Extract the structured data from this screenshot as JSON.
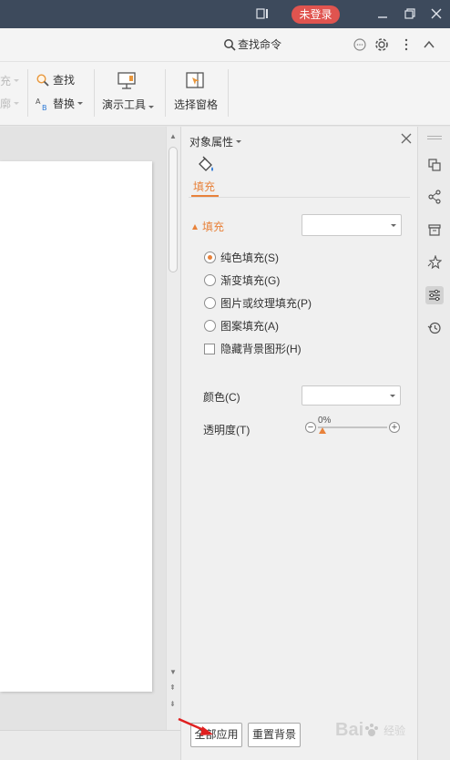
{
  "titlebar": {
    "login_label": "未登录"
  },
  "searchrow": {
    "search_label": "查找命令"
  },
  "ribbon": {
    "faded_top": "充",
    "faded_bottom": "廓",
    "find_label": "查找",
    "replace_label": "替换",
    "present_tools_label": "演示工具",
    "select_pane_label": "选择窗格"
  },
  "panel": {
    "title": "对象属性",
    "tab_fill": "填充",
    "section_fill": "填充",
    "options": [
      "纯色填充(S)",
      "渐变填充(G)",
      "图片或纹理填充(P)",
      "图案填充(A)"
    ],
    "hide_bg_label": "隐藏背景图形(H)",
    "color_label": "颜色(C)",
    "transparency_label": "透明度(T)",
    "transparency_value": "0%",
    "apply_all_label": "全部应用",
    "reset_bg_label": "重置背景"
  },
  "watermark": {
    "text": "Bai",
    "suffix": "经验"
  },
  "colors": {
    "accent": "#e8823b",
    "titlebar": "#3d4a5c",
    "login": "#e0544f",
    "annotation_arrow": "#e02020"
  }
}
